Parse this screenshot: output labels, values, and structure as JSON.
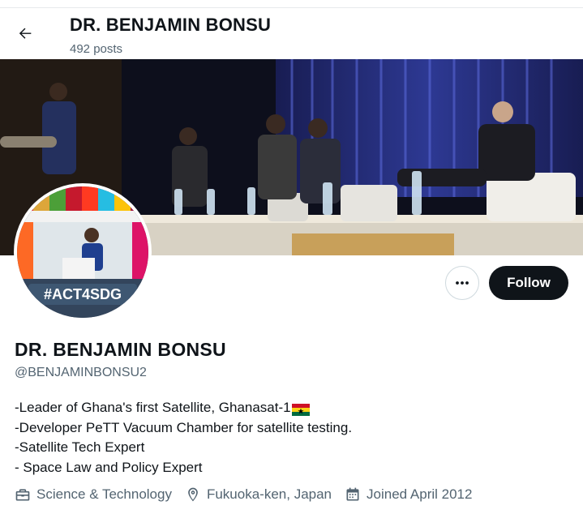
{
  "header": {
    "title": "DR. BENJAMIN BONSU",
    "post_count": "492 posts"
  },
  "profile": {
    "name": "DR. BENJAMIN BONSU",
    "handle": "@BENJAMINBONSU2",
    "avatar_text": "#ACT4SDG",
    "bio": [
      "-Leader of Ghana's first Satellite, Ghanasat-1",
      "-Developer PeTT Vacuum Chamber for satellite testing.",
      "-Satellite Tech Expert",
      "- Space Law and Policy Expert"
    ],
    "flag": "ghana-flag",
    "category": "Science & Technology",
    "location": "Fukuoka-ken, Japan",
    "joined": "Joined April 2012"
  },
  "actions": {
    "follow_label": "Follow",
    "more_icon": "more-icon"
  },
  "colors": {
    "text_primary": "#0f1419",
    "text_secondary": "#536471",
    "follow_bg": "#0f1419",
    "border": "#cfd9de"
  }
}
